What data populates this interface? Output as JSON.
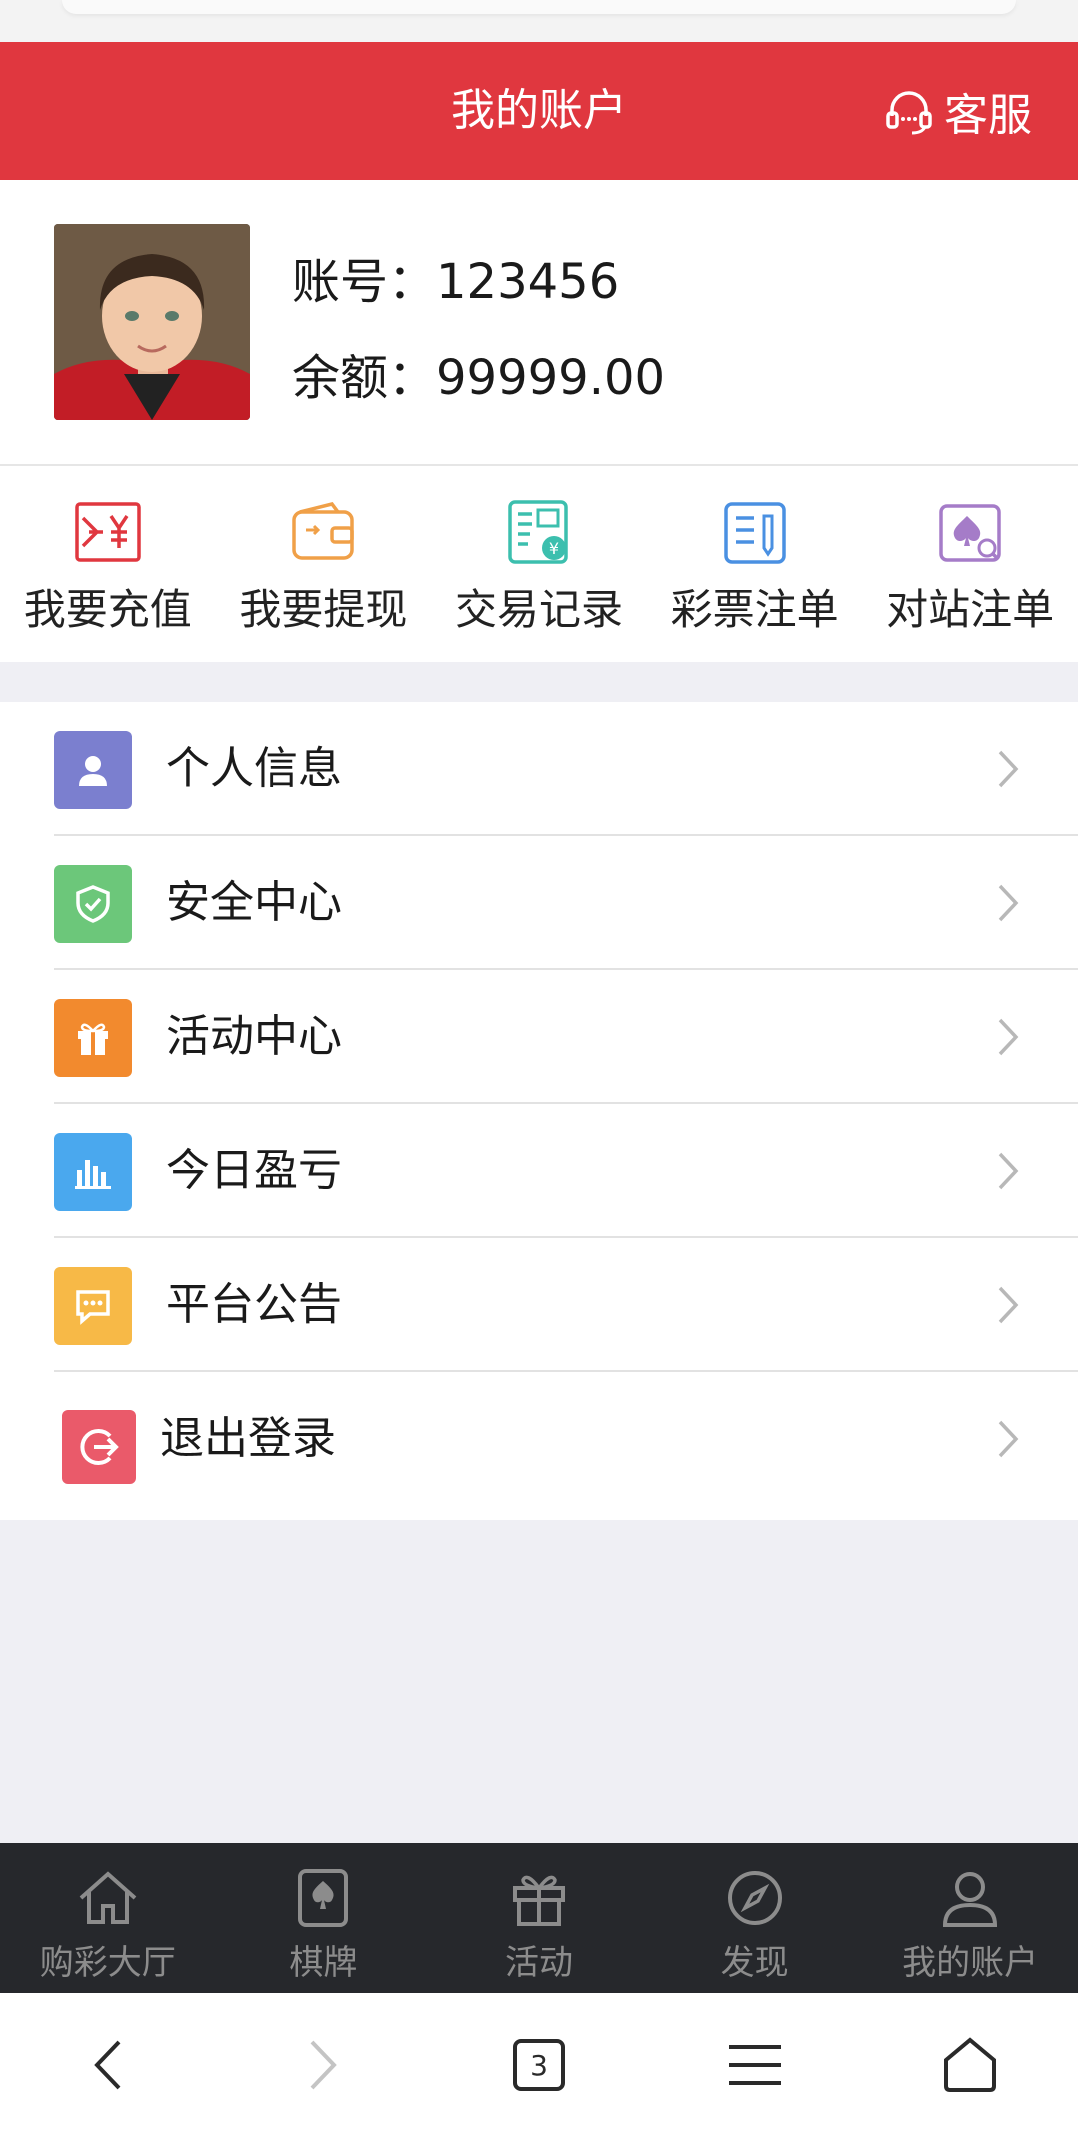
{
  "header": {
    "title": "我的账户",
    "service_label": "客服",
    "accent_color": "#e0373f"
  },
  "profile": {
    "account_label": "账号：",
    "account_value": "123456",
    "balance_label": "余额：",
    "balance_value": "99999.00"
  },
  "shortcuts": [
    {
      "label": "我要充值",
      "icon": "deposit-icon",
      "color": "#e0373f"
    },
    {
      "label": "我要提现",
      "icon": "wallet-icon",
      "color": "#f0a048"
    },
    {
      "label": "交易记录",
      "icon": "transaction-record-icon",
      "color": "#3cbfae"
    },
    {
      "label": "彩票注单",
      "icon": "lottery-ticket-icon",
      "color": "#4a90e2"
    },
    {
      "label": "对站注单",
      "icon": "card-game-order-icon",
      "color": "#a57cc8"
    }
  ],
  "menu": [
    {
      "label": "个人信息",
      "icon": "person-icon",
      "color": "#7b7fcf"
    },
    {
      "label": "安全中心",
      "icon": "shield-icon",
      "color": "#6cc77a"
    },
    {
      "label": "活动中心",
      "icon": "gift-icon",
      "color": "#f28a2e"
    },
    {
      "label": "今日盈亏",
      "icon": "bar-chart-icon",
      "color": "#4aa8ee"
    },
    {
      "label": "平台公告",
      "icon": "announcement-icon",
      "color": "#f7b947"
    },
    {
      "label": "退出登录",
      "icon": "logout-icon",
      "color": "#ea5a6a"
    }
  ],
  "tabbar": [
    {
      "label": "购彩大厅",
      "icon": "home-icon"
    },
    {
      "label": "棋牌",
      "icon": "poker-card-icon"
    },
    {
      "label": "活动",
      "icon": "gift-icon"
    },
    {
      "label": "发现",
      "icon": "compass-icon"
    },
    {
      "label": "我的账户",
      "icon": "user-icon"
    }
  ],
  "browser": {
    "tab_count": "3"
  }
}
